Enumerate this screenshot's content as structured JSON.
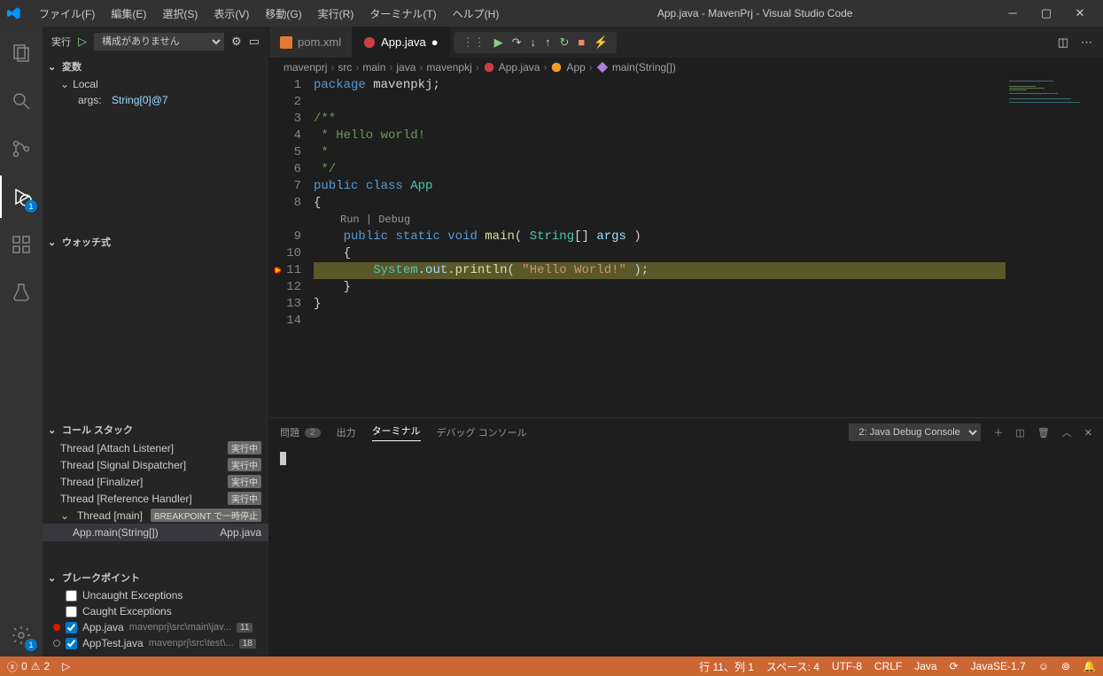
{
  "window": {
    "title": "App.java - MavenPrj - Visual Studio Code"
  },
  "menu": {
    "file": "ファイル(F)",
    "edit": "編集(E)",
    "selection": "選択(S)",
    "view": "表示(V)",
    "go": "移動(G)",
    "run": "実行(R)",
    "terminal": "ターミナル(T)",
    "help": "ヘルプ(H)"
  },
  "activity": {
    "debug_badge": "1",
    "manage_badge": "1"
  },
  "debug": {
    "run_label": "実行",
    "config_placeholder": "構成がありません",
    "variables": "変数",
    "local": "Local",
    "args_label": "args:",
    "args_value": "String[0]@7",
    "watch": "ウォッチ式",
    "callstack": "コール スタック",
    "threads": [
      {
        "name": "Thread [Attach Listener]",
        "status": "実行中"
      },
      {
        "name": "Thread [Signal Dispatcher]",
        "status": "実行中"
      },
      {
        "name": "Thread [Finalizer]",
        "status": "実行中"
      },
      {
        "name": "Thread [Reference Handler]",
        "status": "実行中"
      }
    ],
    "main_thread": "Thread [main]",
    "main_status": "BREAKPOINT で一時停止",
    "frame_method": "App.main(String[])",
    "frame_file": "App.java",
    "breakpoints": "ブレークポイント",
    "bp_uncaught": "Uncaught Exceptions",
    "bp_caught": "Caught Exceptions",
    "bp1_file": "App.java",
    "bp1_path": "mavenprj\\src\\main\\jav...",
    "bp1_line": "11",
    "bp2_file": "AppTest.java",
    "bp2_path": "mavenprj\\src\\test\\...",
    "bp2_line": "18"
  },
  "tabs": {
    "pom": "pom.xml",
    "app": "App.java"
  },
  "breadcrumb": {
    "p0": "mavenprj",
    "p1": "src",
    "p2": "main",
    "p3": "java",
    "p4": "mavenpkj",
    "p5": "App.java",
    "p6": "App",
    "p7": "main(String[])"
  },
  "codelens": "Run | Debug",
  "code": {
    "l1a": "package",
    "l1b": " mavenpkj",
    "l1c": ";",
    "l3": "/**",
    "l4": " * Hello world!",
    "l5": " *",
    "l6": " */",
    "l7a": "public",
    "l7b": "class",
    "l7c": "App",
    "l8": "{",
    "l9a": "public",
    "l9b": "static",
    "l9c": "void",
    "l9d": "main",
    "l9e": "( ",
    "l9f": "String",
    "l9g": "[] ",
    "l9h": "args",
    "l9i": " )",
    "l10": "{",
    "l11a": "System",
    "l11b": ".",
    "l11c": "out",
    "l11d": ".",
    "l11e": "println",
    "l11f": "( ",
    "l11g": "\"Hello World!\"",
    "l11h": " );",
    "l12": "}",
    "l13": "}"
  },
  "lineno": {
    "n1": "1",
    "n2": "2",
    "n3": "3",
    "n4": "4",
    "n5": "5",
    "n6": "6",
    "n7": "7",
    "n8": "8",
    "n9": "9",
    "n10": "10",
    "n11": "11",
    "n12": "12",
    "n13": "13",
    "n14": "14"
  },
  "panel": {
    "problems": "問題",
    "problems_count": "2",
    "output": "出力",
    "terminal": "ターミナル",
    "debug_console": "デバッグ コンソール",
    "terminal_select": "2: Java Debug Console"
  },
  "status": {
    "errors": "0",
    "warnings": "2",
    "line_col": "行 11、列 1",
    "spaces": "スペース: 4",
    "encoding": "UTF-8",
    "eol": "CRLF",
    "lang": "Java",
    "jdk": "JavaSE-1.7"
  }
}
